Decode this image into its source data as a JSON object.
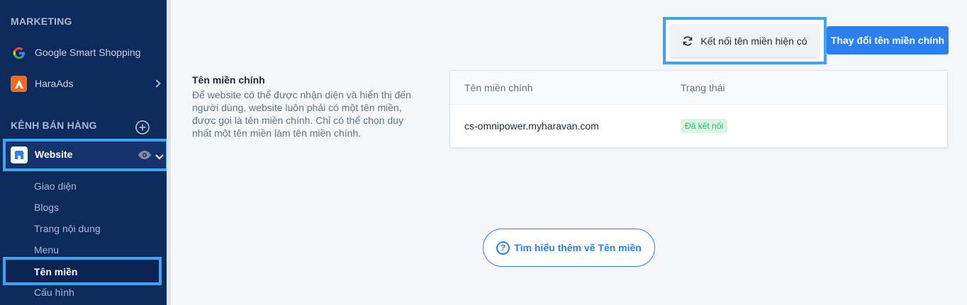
{
  "sidebar": {
    "marketing_heading": "MARKETING",
    "marketing_items": [
      {
        "label": "Google Smart Shopping",
        "icon": "google-icon"
      },
      {
        "label": "HaraAds",
        "icon": "haraads-icon"
      }
    ],
    "sales_heading": "KÊNH BÁN HÀNG",
    "website": {
      "label": "Website",
      "icon": "store-icon"
    },
    "sub_items": [
      "Giao diện",
      "Blogs",
      "Trang nội dung",
      "Menu",
      "Tên miền",
      "Cấu hình"
    ],
    "active_sub": "Tên miền"
  },
  "main": {
    "connect_button": "Kết nối tên miền hiện có",
    "change_button": "Thay đổi tên miền chính",
    "section_title": "Tên miền chính",
    "section_desc": "Để website có thể được nhận diện và hiển thị đến người dùng, website luôn phải có một tên miền, được gọi là tên miền chính. Chỉ có thể chọn duy nhất một tên miền làm tên miền chính.",
    "table": {
      "columns": [
        "Tên miền chính",
        "Trạng thái"
      ],
      "rows": [
        {
          "domain": "cs-omnipower.myharavan.com",
          "status": "Đã kết nối"
        }
      ]
    },
    "learn_more": "Tìm hiểu thêm về Tên miền"
  },
  "colors": {
    "sidebar": "#0d2a5c",
    "primary": "#2b7fee",
    "highlight": "#3fa4f0",
    "success": "#2bb673"
  }
}
